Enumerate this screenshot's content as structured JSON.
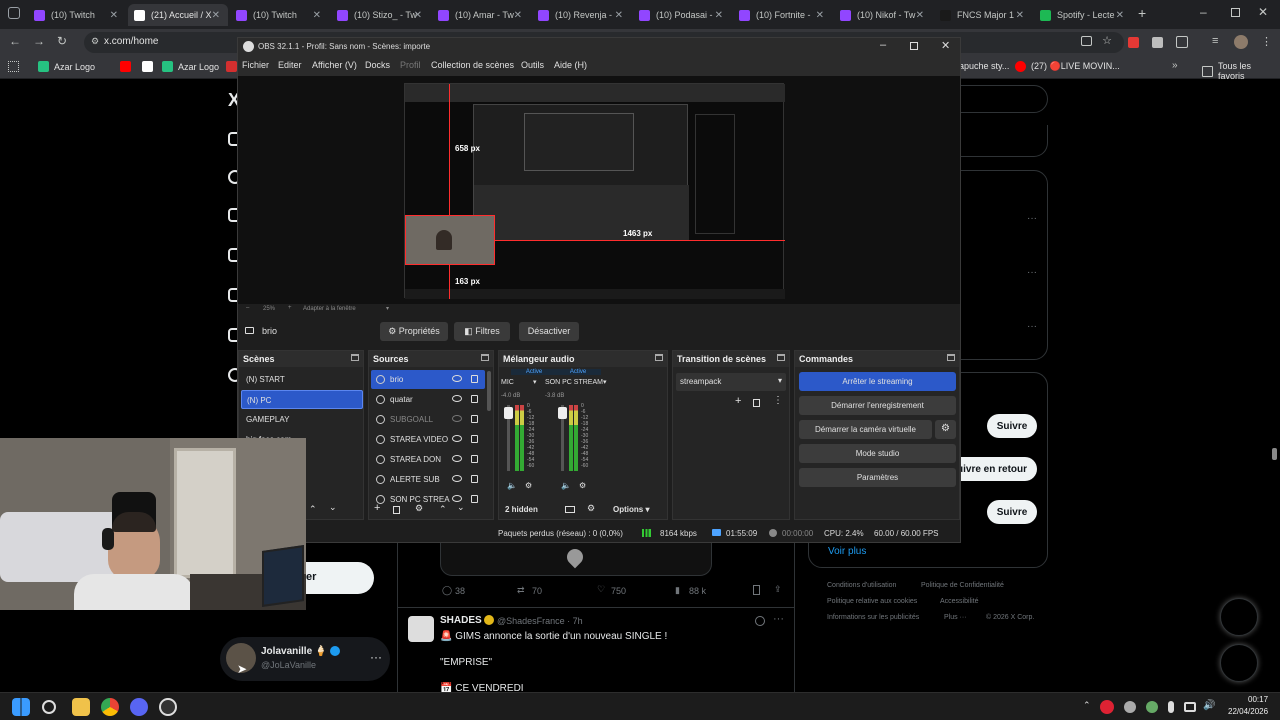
{
  "browser": {
    "tabs": [
      {
        "label": "(10) Twitch",
        "color": "#9146ff"
      },
      {
        "label": "(21) Accueil / X",
        "color": "#ffffff",
        "active": true
      },
      {
        "label": "(10) Twitch",
        "color": "#9146ff"
      },
      {
        "label": "(10) Stizo_ - Tw",
        "color": "#9146ff"
      },
      {
        "label": "(10) Amar - Tw",
        "color": "#9146ff"
      },
      {
        "label": "(10) Revenja -",
        "color": "#9146ff"
      },
      {
        "label": "(10) Podasai -",
        "color": "#9146ff"
      },
      {
        "label": "(10) Fortnite -",
        "color": "#9146ff"
      },
      {
        "label": "(10) Nikof - Tw",
        "color": "#9146ff"
      },
      {
        "label": "FNCS Major 1",
        "color": "#1a1a1a"
      },
      {
        "label": "Spotify - Lecte",
        "color": "#1db954"
      }
    ],
    "url": "x.com/home",
    "bookmarks": [
      "Azar Logo",
      "Azar Logo",
      "apuche sty...",
      "(27) 🔴LIVE MOVIN...",
      "Tous les favoris"
    ]
  },
  "x": {
    "tweet_stats": {
      "replies": "38",
      "retweets": "70",
      "likes": "750",
      "views": "88 k"
    },
    "tweet2": {
      "author": "SHADES",
      "handle": "@ShadesFrance · 7h",
      "line1": "🚨 GIMS annonce la sortie d'un nouveau SINGLE !",
      "line2": "\"EMPRISE\"",
      "line3": "📅 CE VENDREDI"
    },
    "follow_label": "Suivre",
    "follow_back_label": "Suivre en retour",
    "follow_back_visible": "uivre en retour",
    "voir_plus": "Voir plus",
    "footer": {
      "line1a": "Conditions d'utilisation",
      "line1b": "Politique de Confidentialité",
      "line2a": "Politique relative aux cookies",
      "line2b": "Accessibilité",
      "line3a": "Informations sur les publicités",
      "line3b": "Plus ···",
      "line3c": "© 2026 X Corp."
    },
    "profile": {
      "name": "Jolavanille 🍦",
      "handle": "@JoLaVanille"
    },
    "post_button_visible": "er"
  },
  "obs": {
    "title": "OBS 32.1.1 - Profil: Sans nom - Scènes: importe",
    "menu": [
      "Fichier",
      "Editer",
      "Afficher (V)",
      "Docks",
      "Profil",
      "Collection de scènes",
      "Outils",
      "Aide (H)"
    ],
    "preview": {
      "label_top": "658 px",
      "label_right": "1463 px",
      "label_bottom": "163 px"
    },
    "zoom": {
      "value": "25%",
      "fit": "Adapter à la fenêtre"
    },
    "source_toolbar": {
      "name": "brio",
      "properties": "Propriétés",
      "filters": "Filtres",
      "deactivate": "Désactiver"
    },
    "scenes": {
      "title": "Scènes",
      "items": [
        "(N) START",
        "(N) PC",
        "GAMEPLAY",
        "big face cam"
      ]
    },
    "sources": {
      "title": "Sources",
      "items": [
        "brio",
        "quatar",
        "SUBGOALL",
        "STAREA VIDEO",
        "STAREA DON",
        "ALERTE SUB",
        "SON PC STREA"
      ]
    },
    "mixer": {
      "title": "Mélangeur audio",
      "channels": [
        {
          "name": "MIC",
          "status": "Active",
          "db": "-4.0 dB"
        },
        {
          "name": "SON PC STREAM",
          "status": "Active",
          "db": "-3.8 dB"
        }
      ],
      "ticks": [
        "0",
        "-6",
        "-12",
        "-18",
        "-24",
        "-30",
        "-36",
        "-42",
        "-48",
        "-54",
        "-60"
      ],
      "hidden": "2 hidden",
      "options": "Options"
    },
    "transitions": {
      "title": "Transition de scènes",
      "selected": "streampack"
    },
    "commands": {
      "title": "Commandes",
      "stop_stream": "Arrêter le streaming",
      "start_rec": "Démarrer l'enregistrement",
      "start_vcam": "Démarrer la caméra virtuelle",
      "studio": "Mode studio",
      "settings": "Paramètres"
    },
    "status": {
      "dropped": "Paquets perdus (réseau) : 0 (0,0%)",
      "bitrate": "8164 kbps",
      "stream_time": "01:55:09",
      "rec_time": "00:00:00",
      "cpu": "CPU: 2.4%",
      "fps": "60.00 / 60.00 FPS"
    }
  },
  "taskbar": {
    "time": "00:17",
    "date": "22/04/2026"
  }
}
